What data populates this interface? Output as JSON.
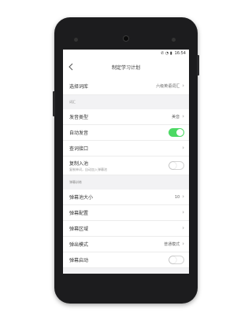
{
  "status": {
    "icons": "✆ ◔ ▮",
    "time": "16:54"
  },
  "nav": {
    "title": "制定学习计划"
  },
  "rows": {
    "lexicon": {
      "label": "选择词库",
      "value": "六级英语词汇"
    },
    "pron_type": {
      "label": "发音类型",
      "value": "美音"
    },
    "auto_pron": {
      "label": "自动发音",
      "on": true
    },
    "query_api": {
      "label": "查词接口"
    },
    "copy_add": {
      "label": "复制入池",
      "sub": "复制单词，自动加入弹幕池",
      "on": false
    },
    "pool_size": {
      "label": "弹幕池大小",
      "value": "10"
    },
    "config": {
      "label": "弹幕配置"
    },
    "area": {
      "label": "弹幕区域"
    },
    "mode": {
      "label": "弹出模式",
      "value": "普通模式"
    },
    "start": {
      "label": "弹幕启动",
      "on": false
    }
  },
  "sections": {
    "vocab": "词汇",
    "danmaku": "弹幕训练"
  },
  "colors": {
    "toggle_on": "#4cd964"
  },
  "icons": {
    "back": "chevron-left-icon",
    "row_arrow": "chevron-right-icon"
  }
}
